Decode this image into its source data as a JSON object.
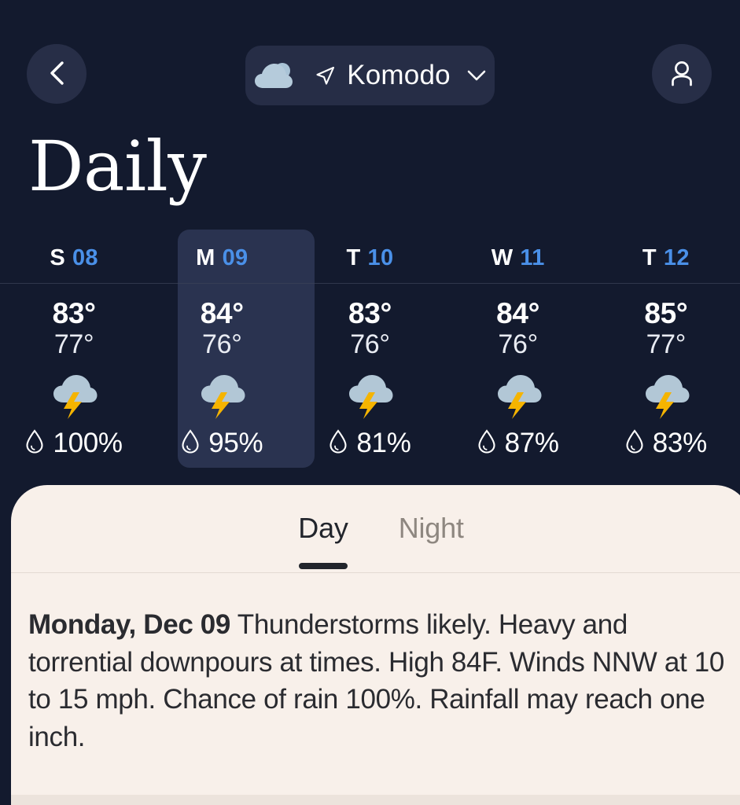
{
  "app": {
    "background_color": "#131a2e",
    "accent_blue": "#4a90e8",
    "sheet_color": "#f8f0ea"
  },
  "header": {
    "back_icon": "chevron-left-icon",
    "profile_icon": "person-icon",
    "location": {
      "weather_icon": "cloud-icon",
      "gps_icon": "navigation-arrow-icon",
      "name": "Komodo",
      "chevron_icon": "chevron-down-icon"
    }
  },
  "page_title": "Daily",
  "days": [
    {
      "letter": "S",
      "date": "08",
      "high": "83°",
      "low": "77°",
      "condition_icon": "thunderstorm-icon",
      "precip_icon": "water-drop-icon",
      "precip": "100%",
      "selected": false
    },
    {
      "letter": "M",
      "date": "09",
      "high": "84°",
      "low": "76°",
      "condition_icon": "thunderstorm-icon",
      "precip_icon": "water-drop-icon",
      "precip": "95%",
      "selected": true
    },
    {
      "letter": "T",
      "date": "10",
      "high": "83°",
      "low": "76°",
      "condition_icon": "thunderstorm-icon",
      "precip_icon": "water-drop-icon",
      "precip": "81%",
      "selected": false
    },
    {
      "letter": "W",
      "date": "11",
      "high": "84°",
      "low": "76°",
      "condition_icon": "thunderstorm-icon",
      "precip_icon": "water-drop-icon",
      "precip": "87%",
      "selected": false
    },
    {
      "letter": "T",
      "date": "12",
      "high": "85°",
      "low": "77°",
      "condition_icon": "thunderstorm-icon",
      "precip_icon": "water-drop-icon",
      "precip": "83%",
      "selected": false
    }
  ],
  "detail": {
    "tabs": [
      {
        "label": "Day",
        "active": true
      },
      {
        "label": "Night",
        "active": false
      }
    ],
    "forecast_date": "Monday, Dec 09",
    "forecast_text": " Thunderstorms likely. Heavy and torrential downpours at times. High 84F. Winds NNW at 10 to 15 mph. Chance of rain 100%. Rainfall may reach one inch."
  }
}
